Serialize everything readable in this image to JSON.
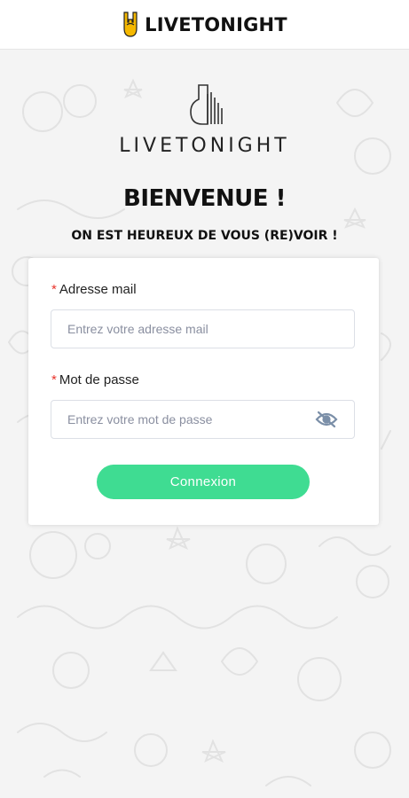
{
  "header": {
    "brand": "LIVETONIGHT",
    "brand_color": "#f5b800"
  },
  "logo": {
    "text": "LIVETONIGHT"
  },
  "welcome": {
    "title": "BIENVENUE !",
    "subtitle": "ON EST HEUREUX DE VOUS (RE)VOIR !"
  },
  "form": {
    "email": {
      "required_mark": "*",
      "label": "Adresse mail",
      "value": "",
      "placeholder": "Entrez votre adresse mail"
    },
    "password": {
      "required_mark": "*",
      "label": "Mot de passe",
      "value": "",
      "placeholder": "Entrez votre mot de passe",
      "toggle_icon": "eye-off-icon"
    },
    "submit_label": "Connexion",
    "submit_color": "#3fdc92"
  }
}
